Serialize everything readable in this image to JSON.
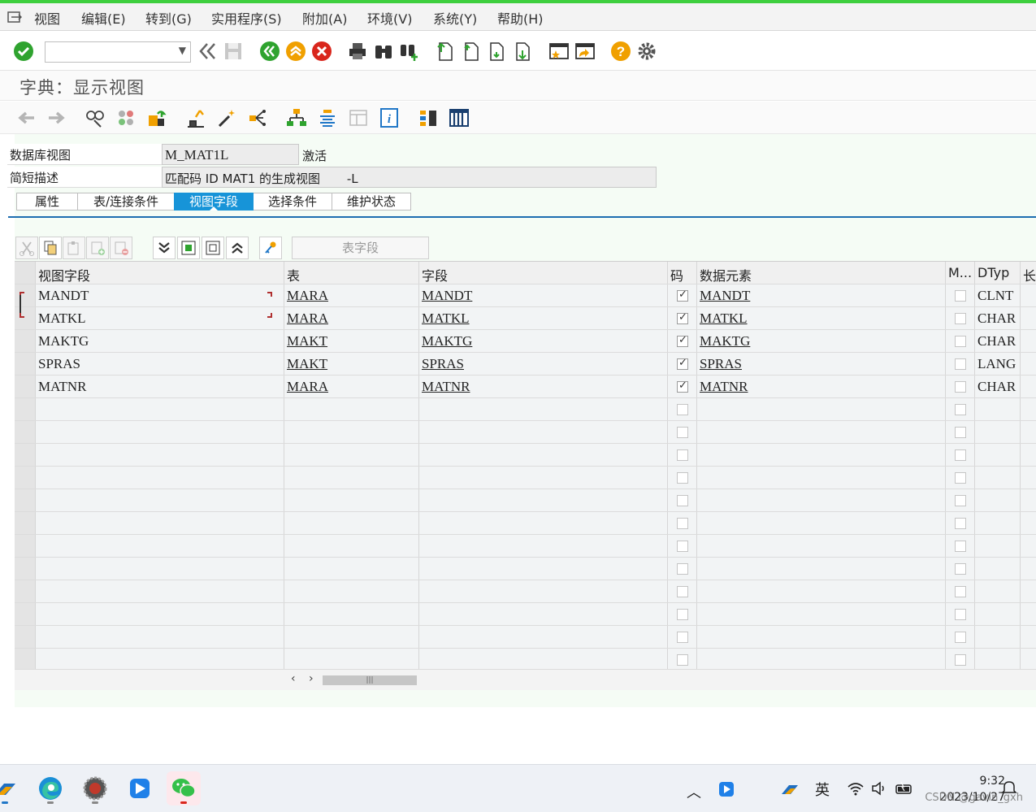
{
  "menu": {
    "items": [
      "视图",
      "编辑(E)",
      "转到(G)",
      "实用程序(S)",
      "附加(A)",
      "环境(V)",
      "系统(Y)",
      "帮助(H)"
    ]
  },
  "toolbar": {
    "command_value": "",
    "icons": [
      "check-icon",
      "back-double-icon",
      "save-icon",
      "back-green-icon",
      "exit-icon",
      "cancel-icon",
      "print-icon",
      "find-icon",
      "find-next-icon",
      "first-page-icon",
      "prev-page-icon",
      "next-page-icon",
      "last-page-icon",
      "new-session-icon",
      "shortcut-icon",
      "help-icon",
      "settings-icon"
    ]
  },
  "page": {
    "title": "字典：显示视图"
  },
  "header": {
    "db_view_label": "数据库视图",
    "db_view_value": "M_MAT1L",
    "status": "激活",
    "short_desc_label": "简短描述",
    "short_desc_value": "匹配码 ID MAT1 的生成视图",
    "short_desc_suffix": "-L"
  },
  "tabs": [
    "属性",
    "表/连接条件",
    "视图字段",
    "选择条件",
    "维护状态"
  ],
  "active_tab": 2,
  "table_field_button": "表字段",
  "grid": {
    "columns": [
      "视图字段",
      "表",
      "字段",
      "码",
      "数据元素",
      "M...",
      "DTyp",
      "长"
    ],
    "rows": [
      {
        "view_field": "MANDT",
        "table": "MARA",
        "field": "MANDT",
        "key": true,
        "data_element": "MANDT",
        "m": false,
        "dtype": "CLNT"
      },
      {
        "view_field": "MATKL",
        "table": "MARA",
        "field": "MATKL",
        "key": true,
        "data_element": "MATKL",
        "m": false,
        "dtype": "CHAR"
      },
      {
        "view_field": "MAKTG",
        "table": "MAKT",
        "field": "MAKTG",
        "key": true,
        "data_element": "MAKTG",
        "m": false,
        "dtype": "CHAR"
      },
      {
        "view_field": "SPRAS",
        "table": "MAKT",
        "field": "SPRAS",
        "key": true,
        "data_element": "SPRAS",
        "m": false,
        "dtype": "LANG"
      },
      {
        "view_field": "MATNR",
        "table": "MARA",
        "field": "MATNR",
        "key": true,
        "data_element": "MATNR",
        "m": false,
        "dtype": "CHAR"
      }
    ],
    "empty_rows": 12
  },
  "taskbar": {
    "input_lang": "英",
    "time": "9:32",
    "date": "2023/10/27",
    "watermark": "CSDN @gavin_gxh"
  },
  "colors": {
    "accent": "#1794d8",
    "green": "#2fa32f",
    "orange": "#f0a000",
    "red": "#d9261c"
  }
}
